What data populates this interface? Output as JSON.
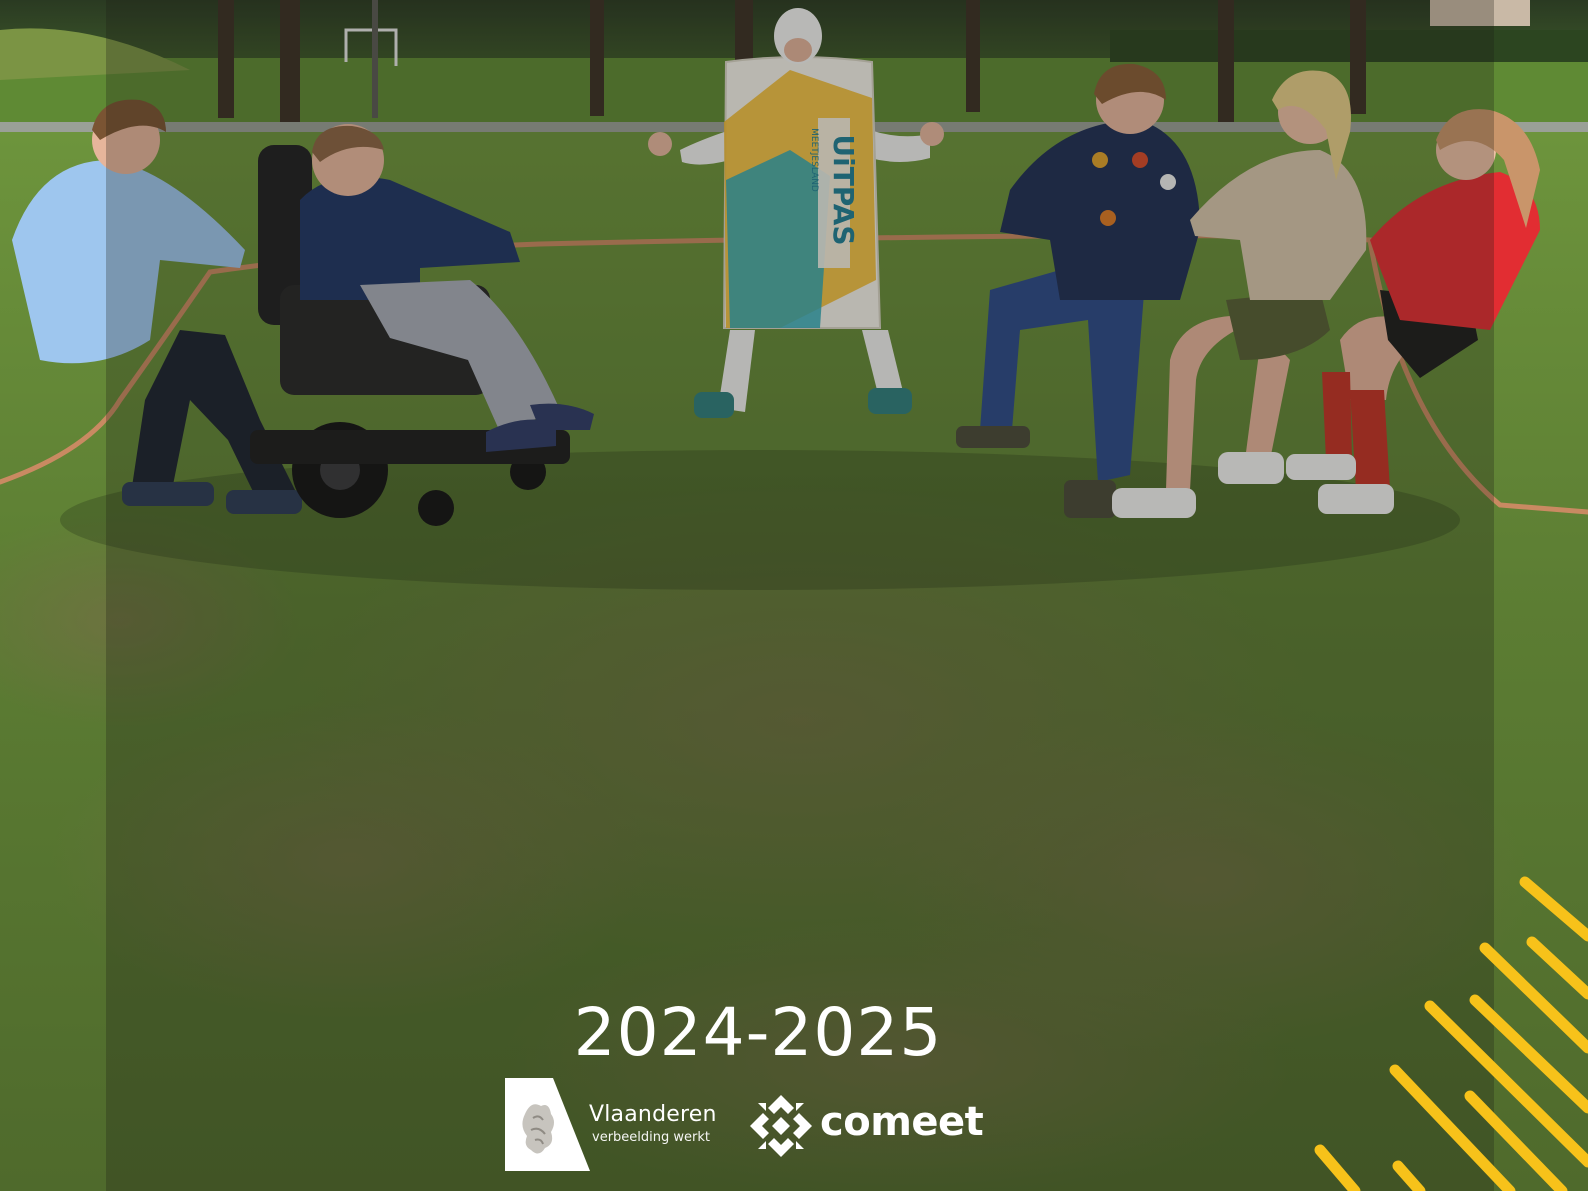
{
  "cover": {
    "year": "2024-2025"
  },
  "logos": {
    "vlaanderen": {
      "name": "Vlaanderen",
      "tagline": "verbeelding werkt"
    },
    "comeet": {
      "name": "comeet"
    }
  },
  "colors": {
    "accent_yellow": "#f7c21a",
    "grass": "#5f7f37",
    "text": "#ffffff"
  },
  "photo": {
    "costume_text": "UiTPAS",
    "costume_subtext": "MEETJESLAND"
  }
}
